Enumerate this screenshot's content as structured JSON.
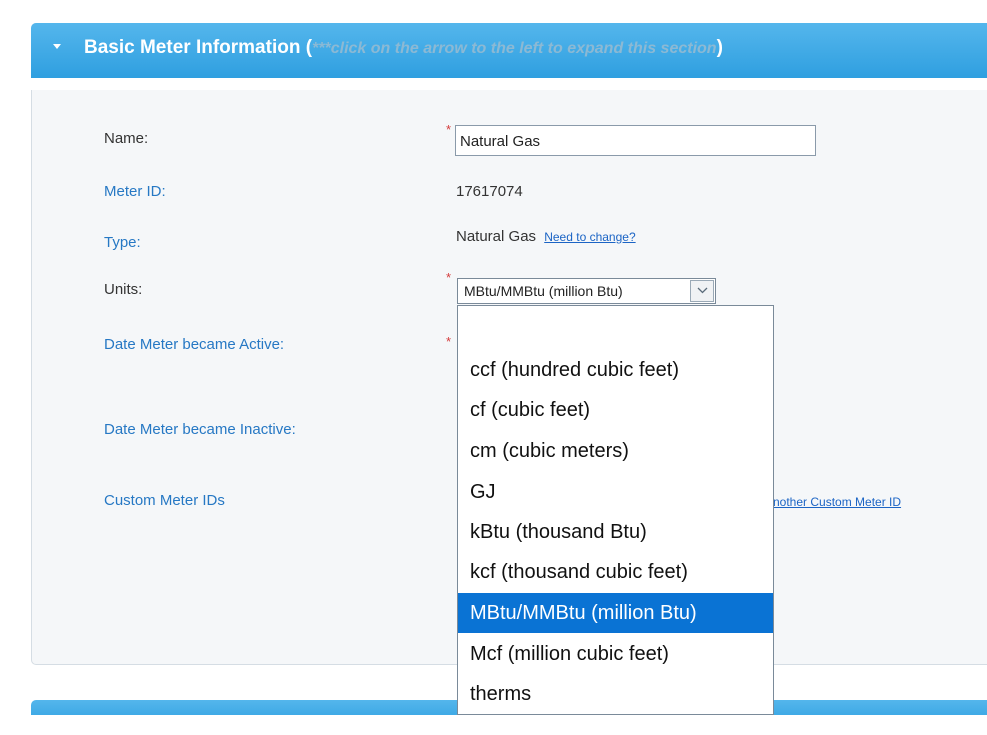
{
  "section": {
    "title": "Basic Meter Information",
    "paren_open": "(",
    "note": "***click on the arrow to the left to expand this section",
    "paren_close": ")"
  },
  "fields": {
    "name_label": "Name:",
    "name_value": "Natural Gas",
    "meter_id_label": "Meter ID:",
    "meter_id_value": "17617074",
    "type_label": "Type:",
    "type_value": "Natural Gas",
    "type_change_link": "Need to change?",
    "units_label": "Units:",
    "units_selected": "MBtu/MMBtu (million Btu)",
    "date_active_label": "Date Meter became Active:",
    "date_inactive_label": "Date Meter became Inactive:",
    "custom_ids_label": "Custom Meter IDs",
    "custom_ids_link_partial": "nother Custom Meter ID"
  },
  "required_marker": "*",
  "units_dropdown": {
    "options": [
      "",
      "ccf (hundred cubic feet)",
      "cf (cubic feet)",
      "cm (cubic meters)",
      "GJ",
      "kBtu (thousand Btu)",
      "kcf (thousand cubic feet)",
      "MBtu/MMBtu (million Btu)",
      "Mcf (million cubic feet)",
      "therms"
    ],
    "selected_index": 7
  },
  "colors": {
    "header_blue": "#3aa8e6",
    "selected_option": "#0a73d4",
    "link_blue": "#2678c4",
    "required_red": "#d43b3b"
  }
}
